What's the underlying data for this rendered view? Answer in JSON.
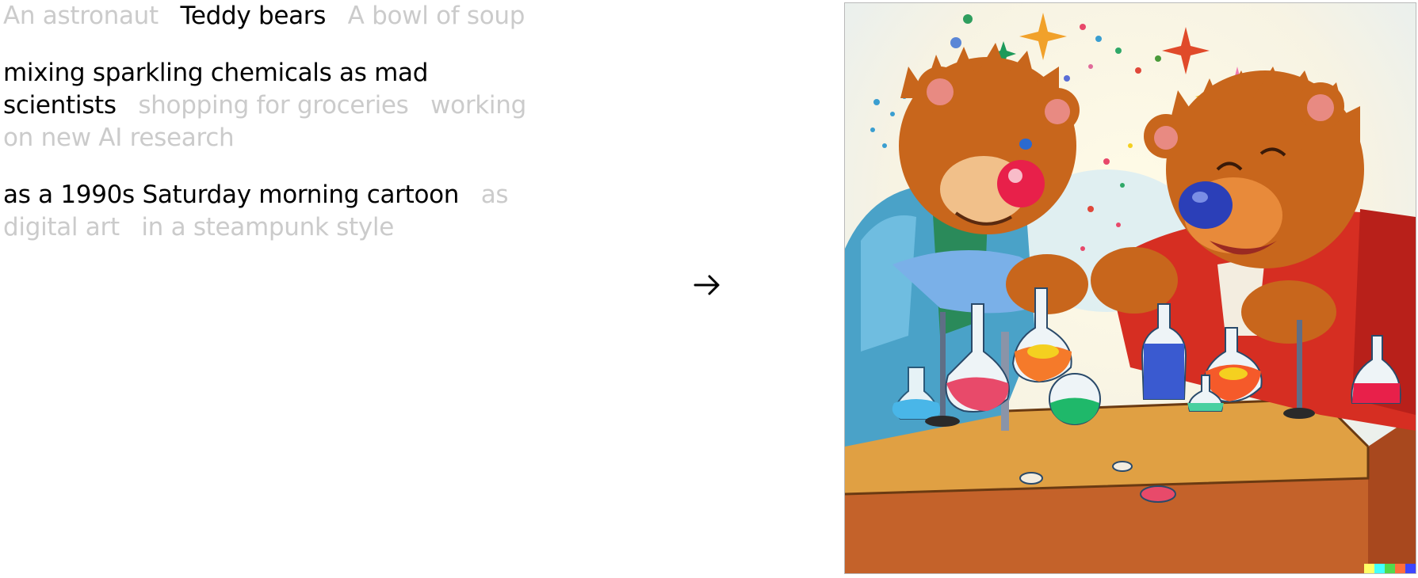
{
  "prompt": {
    "subjects": [
      {
        "label": "An astronaut",
        "selected": false
      },
      {
        "label": "Teddy bears",
        "selected": true
      },
      {
        "label": "A bowl of soup",
        "selected": false
      }
    ],
    "activities": [
      {
        "label": "mixing sparkling chemicals as mad scientists",
        "selected": true
      },
      {
        "label": "shopping for groceries",
        "selected": false
      },
      {
        "label": "working on new AI research",
        "selected": false
      }
    ],
    "styles": [
      {
        "label": "as a 1990s Saturday morning cartoon",
        "selected": true
      },
      {
        "label": "as digital art",
        "selected": false
      },
      {
        "label": "in a steampunk style",
        "selected": false
      }
    ]
  },
  "arrow_icon": "arrow-right-icon",
  "image": {
    "subject": "teddy bears mixing sparkling chemicals, cartoon illustration"
  },
  "colors": {
    "selected_text": "#000000",
    "unselected_text": "#cbcbcb",
    "bear_fur": "#c8661c",
    "table": "#e0a043"
  }
}
